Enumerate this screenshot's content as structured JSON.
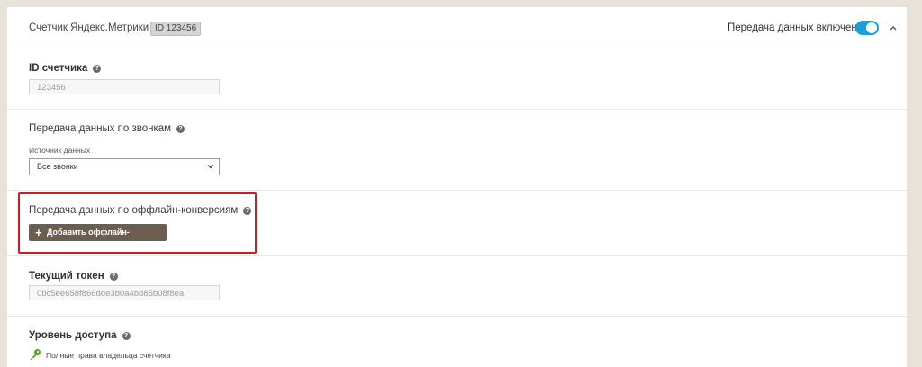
{
  "header": {
    "title": "Счетчик Яндекс.Метрики",
    "id_badge": "ID 123456",
    "status_label": "Передача данных включена",
    "toggle_on": true,
    "accent_color": "#1a9fd8"
  },
  "counter_id": {
    "label": "ID счетчика",
    "value": "123456"
  },
  "calls": {
    "label": "Передача данных по звонкам",
    "source_label": "Источник данных",
    "source_value": "Все звонки"
  },
  "offline": {
    "label": "Передача данных по оффлайн-конверсиям",
    "button_label": "Добавить оффлайн-конверсию",
    "highlight_color": "#c81e24"
  },
  "token": {
    "label": "Текущий токен",
    "value": "0bc5ee658f866dde3b0a4bd85b08f8ea"
  },
  "access": {
    "label": "Уровень доступа",
    "value": "Полные права владельца счетчика"
  },
  "icons": {
    "help": "help-icon",
    "collapse": "chevron-up-icon",
    "select": "chevron-down-icon",
    "key": "key-icon",
    "plus": "plus-icon"
  }
}
